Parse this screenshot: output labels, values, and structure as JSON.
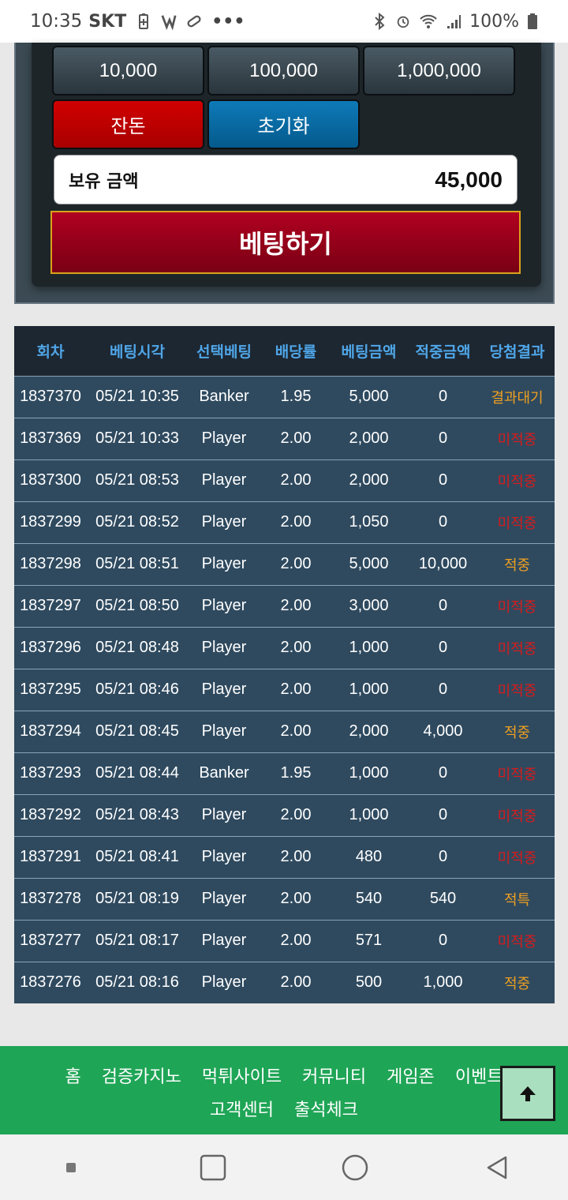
{
  "status_bar": {
    "time": "10:35",
    "carrier": "SKT",
    "battery": "100%"
  },
  "panel": {
    "amount_buttons": [
      "10,000",
      "100,000",
      "1,000,000"
    ],
    "change_label": "잔돈",
    "reset_label": "초기화",
    "balance_label": "보유 금액",
    "balance_value": "45,000",
    "bet_label": "베팅하기"
  },
  "table": {
    "headers": [
      "회차",
      "베팅시각",
      "선택베팅",
      "배당률",
      "베팅금액",
      "적중금액",
      "당첨결과"
    ],
    "rows": [
      [
        "1837370",
        "05/21 10:35",
        "Banker",
        "1.95",
        "5,000",
        "0",
        "결과대기"
      ],
      [
        "1837369",
        "05/21 10:33",
        "Player",
        "2.00",
        "2,000",
        "0",
        "미적중"
      ],
      [
        "1837300",
        "05/21 08:53",
        "Player",
        "2.00",
        "2,000",
        "0",
        "미적중"
      ],
      [
        "1837299",
        "05/21 08:52",
        "Player",
        "2.00",
        "1,050",
        "0",
        "미적중"
      ],
      [
        "1837298",
        "05/21 08:51",
        "Player",
        "2.00",
        "5,000",
        "10,000",
        "적중"
      ],
      [
        "1837297",
        "05/21 08:50",
        "Player",
        "2.00",
        "3,000",
        "0",
        "미적중"
      ],
      [
        "1837296",
        "05/21 08:48",
        "Player",
        "2.00",
        "1,000",
        "0",
        "미적중"
      ],
      [
        "1837295",
        "05/21 08:46",
        "Player",
        "2.00",
        "1,000",
        "0",
        "미적중"
      ],
      [
        "1837294",
        "05/21 08:45",
        "Player",
        "2.00",
        "2,000",
        "4,000",
        "적중"
      ],
      [
        "1837293",
        "05/21 08:44",
        "Banker",
        "1.95",
        "1,000",
        "0",
        "미적중"
      ],
      [
        "1837292",
        "05/21 08:43",
        "Player",
        "2.00",
        "1,000",
        "0",
        "미적중"
      ],
      [
        "1837291",
        "05/21 08:41",
        "Player",
        "2.00",
        "480",
        "0",
        "미적중"
      ],
      [
        "1837278",
        "05/21 08:19",
        "Player",
        "2.00",
        "540",
        "540",
        "적특"
      ],
      [
        "1837277",
        "05/21 08:17",
        "Player",
        "2.00",
        "571",
        "0",
        "미적중"
      ],
      [
        "1837276",
        "05/21 08:16",
        "Player",
        "2.00",
        "500",
        "1,000",
        "적중"
      ]
    ]
  },
  "footer": {
    "row1": [
      "홈",
      "검증카지노",
      "먹튀사이트",
      "커뮤니티",
      "게임존",
      "이벤트"
    ],
    "row2": [
      "고객센터",
      "출석체크"
    ]
  },
  "colors": {
    "pending": "#f0a020",
    "miss": "#d81b1b",
    "hit": "#f0a020",
    "footer_bg": "#1fa556"
  }
}
